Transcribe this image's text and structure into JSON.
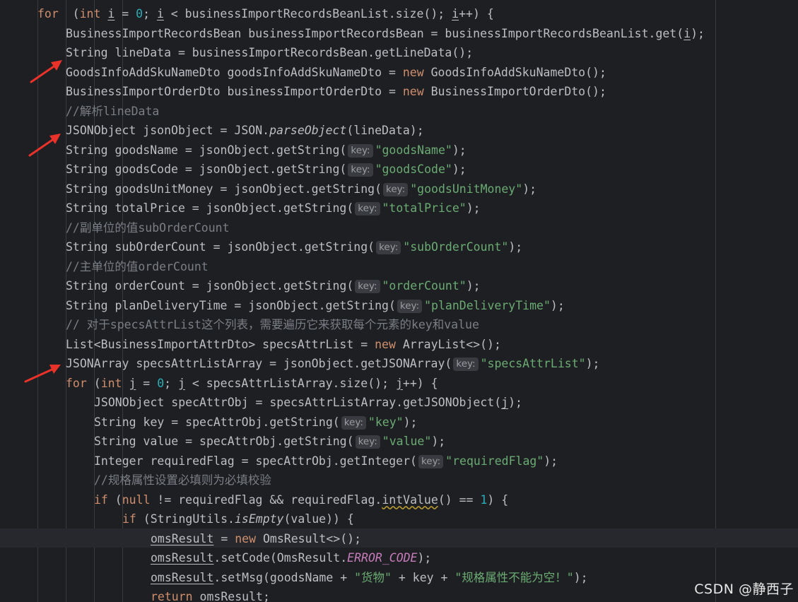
{
  "code": {
    "lines": [
      {
        "indent": 1,
        "tokens": [
          [
            "kw",
            "for"
          ],
          [
            "",
            "  ("
          ],
          [
            "kw",
            "int"
          ],
          [
            "",
            " "
          ],
          [
            "ul",
            "i"
          ],
          [
            "",
            " = "
          ],
          [
            "num",
            "0"
          ],
          [
            "",
            "; "
          ],
          [
            "ul",
            "i"
          ],
          [
            "",
            " < businessImportRecordsBeanList.size(); "
          ],
          [
            "ul",
            "i"
          ],
          [
            "",
            "++) {"
          ]
        ]
      },
      {
        "indent": 2,
        "tokens": [
          [
            "",
            "BusinessImportRecordsBean businessImportRecordsBean = businessImportRecordsBeanList.get("
          ],
          [
            "ul",
            "i"
          ],
          [
            "",
            ");"
          ]
        ]
      },
      {
        "indent": 2,
        "tokens": [
          [
            "",
            "String lineData = businessImportRecordsBean.getLineData();"
          ]
        ]
      },
      {
        "indent": 2,
        "tokens": [
          [
            "",
            "GoodsInfoAddSkuNameDto goodsInfoAddSkuNameDto = "
          ],
          [
            "kw",
            "new"
          ],
          [
            "",
            " GoodsInfoAddSkuNameDto();"
          ]
        ]
      },
      {
        "indent": 2,
        "tokens": [
          [
            "",
            "BusinessImportOrderDto businessImportOrderDto = "
          ],
          [
            "kw",
            "new"
          ],
          [
            "",
            " BusinessImportOrderDto();"
          ]
        ]
      },
      {
        "indent": 2,
        "tokens": [
          [
            "cm",
            "//解析lineData"
          ]
        ]
      },
      {
        "indent": 2,
        "tokens": [
          [
            "",
            "JSONObject jsonObject = JSON."
          ],
          [
            "it",
            "parseObject"
          ],
          [
            "",
            "(lineData);"
          ]
        ]
      },
      {
        "indent": 2,
        "tokens": [
          [
            "",
            "String goodsName = jsonObject.getString("
          ],
          [
            "hint",
            "key:"
          ],
          [
            "str",
            "\"goodsName\""
          ],
          [
            "",
            ");"
          ]
        ]
      },
      {
        "indent": 2,
        "tokens": [
          [
            "",
            "String goodsCode = jsonObject.getString("
          ],
          [
            "hint",
            "key:"
          ],
          [
            "str",
            "\"goodsCode\""
          ],
          [
            "",
            ");"
          ]
        ]
      },
      {
        "indent": 2,
        "tokens": [
          [
            "",
            "String goodsUnitMoney = jsonObject.getString("
          ],
          [
            "hint",
            "key:"
          ],
          [
            "str",
            "\"goodsUnitMoney\""
          ],
          [
            "",
            ");"
          ]
        ]
      },
      {
        "indent": 2,
        "tokens": [
          [
            "",
            "String totalPrice = jsonObject.getString("
          ],
          [
            "hint",
            "key:"
          ],
          [
            "str",
            "\"totalPrice\""
          ],
          [
            "",
            ");"
          ]
        ]
      },
      {
        "indent": 2,
        "tokens": [
          [
            "cm",
            "//副单位的值subOrderCount"
          ]
        ]
      },
      {
        "indent": 2,
        "tokens": [
          [
            "",
            "String subOrderCount = jsonObject.getString("
          ],
          [
            "hint",
            "key:"
          ],
          [
            "str",
            "\"subOrderCount\""
          ],
          [
            "",
            ");"
          ]
        ]
      },
      {
        "indent": 2,
        "tokens": [
          [
            "cm",
            "//主单位的值orderCount"
          ]
        ]
      },
      {
        "indent": 2,
        "tokens": [
          [
            "",
            "String orderCount = jsonObject.getString("
          ],
          [
            "hint",
            "key:"
          ],
          [
            "str",
            "\"orderCount\""
          ],
          [
            "",
            ");"
          ]
        ]
      },
      {
        "indent": 2,
        "tokens": [
          [
            "",
            "String planDeliveryTime = jsonObject.getString("
          ],
          [
            "hint",
            "key:"
          ],
          [
            "str",
            "\"planDeliveryTime\""
          ],
          [
            "",
            ");"
          ]
        ]
      },
      {
        "indent": 2,
        "tokens": [
          [
            "cm",
            "// 对于specsAttrList这个列表，需要遍历它来获取每个元素的key和value"
          ]
        ]
      },
      {
        "indent": 2,
        "tokens": [
          [
            "",
            "List<BusinessImportAttrDto> specsAttrList = "
          ],
          [
            "kw",
            "new"
          ],
          [
            "",
            " ArrayList<>();"
          ]
        ]
      },
      {
        "indent": 2,
        "tokens": [
          [
            "",
            "JSONArray specsAttrListArray = jsonObject.getJSONArray("
          ],
          [
            "hint",
            "key:"
          ],
          [
            "str",
            "\"specsAttrList\""
          ],
          [
            "",
            ");"
          ]
        ]
      },
      {
        "indent": 2,
        "tokens": [
          [
            "kw",
            "for"
          ],
          [
            "",
            " ("
          ],
          [
            "kw",
            "int"
          ],
          [
            "",
            " "
          ],
          [
            "ul",
            "j"
          ],
          [
            "",
            " = "
          ],
          [
            "num",
            "0"
          ],
          [
            "",
            "; "
          ],
          [
            "ul",
            "j"
          ],
          [
            "",
            " < specsAttrListArray.size(); "
          ],
          [
            "ul",
            "j"
          ],
          [
            "",
            "++) {"
          ]
        ]
      },
      {
        "indent": 3,
        "tokens": [
          [
            "",
            "JSONObject specAttrObj = specsAttrListArray.getJSONObject("
          ],
          [
            "ul",
            "j"
          ],
          [
            "",
            ");"
          ]
        ]
      },
      {
        "indent": 3,
        "tokens": [
          [
            "",
            "String key = specAttrObj.getString("
          ],
          [
            "hint",
            "key:"
          ],
          [
            "str",
            "\"key\""
          ],
          [
            "",
            ");"
          ]
        ]
      },
      {
        "indent": 3,
        "tokens": [
          [
            "",
            "String value = specAttrObj.getString("
          ],
          [
            "hint",
            "key:"
          ],
          [
            "str",
            "\"value\""
          ],
          [
            "",
            ");"
          ]
        ]
      },
      {
        "indent": 3,
        "tokens": [
          [
            "",
            "Integer requiredFlag = specAttrObj.getInteger("
          ],
          [
            "hint",
            "key:"
          ],
          [
            "str",
            "\"requiredFlag\""
          ],
          [
            "",
            ");"
          ]
        ]
      },
      {
        "indent": 3,
        "tokens": [
          [
            "cm",
            "//规格属性设置必填则为必填校验"
          ]
        ]
      },
      {
        "indent": 3,
        "tokens": [
          [
            "kw",
            "if"
          ],
          [
            "",
            " ("
          ],
          [
            "kw",
            "null"
          ],
          [
            "",
            " != requiredFlag && requiredFlag."
          ],
          [
            "wavy",
            "intValue"
          ],
          [
            "",
            "() == "
          ],
          [
            "num",
            "1"
          ],
          [
            "",
            ") {"
          ]
        ]
      },
      {
        "indent": 4,
        "tokens": [
          [
            "kw",
            "if"
          ],
          [
            "",
            " (StringUtils."
          ],
          [
            "it",
            "isEmpty"
          ],
          [
            "",
            "(value)) {"
          ]
        ]
      },
      {
        "indent": 5,
        "tokens": [
          [
            "ul",
            "omsResult"
          ],
          [
            "",
            " = "
          ],
          [
            "kw",
            "new"
          ],
          [
            "",
            " OmsResult<>();"
          ]
        ]
      },
      {
        "indent": 5,
        "tokens": [
          [
            "ul",
            "omsResult"
          ],
          [
            "",
            ".setCode(OmsResult."
          ],
          [
            "const",
            "ERROR_CODE"
          ],
          [
            "",
            ");"
          ]
        ]
      },
      {
        "indent": 5,
        "tokens": [
          [
            "ul",
            "omsResult"
          ],
          [
            "",
            ".setMsg(goodsName + "
          ],
          [
            "str",
            "\"货物\""
          ],
          [
            "",
            " + key + "
          ],
          [
            "str",
            "\"规格属性不能为空！\""
          ],
          [
            "",
            ");"
          ]
        ]
      },
      {
        "indent": 5,
        "tokens": [
          [
            "kw",
            "return"
          ],
          [
            "",
            " omsResult;"
          ]
        ]
      }
    ]
  },
  "watermark": "CSDN @静西子",
  "colors": {
    "background": "#1e1f22",
    "keyword": "#cf8e6d",
    "string": "#6aab73",
    "number": "#2aacb8",
    "comment": "#7a7e85",
    "arrow": "#e8322a"
  }
}
